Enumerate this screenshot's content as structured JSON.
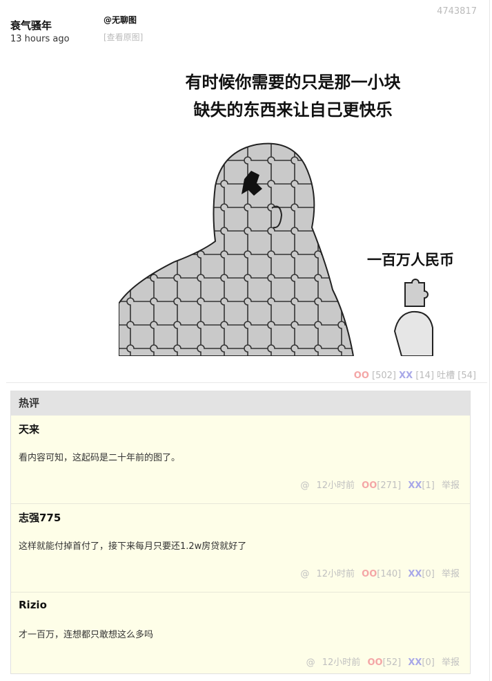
{
  "post": {
    "author": "衰气骚年",
    "time": "13 hours ago",
    "tag": "@无聊图",
    "view_original": "[查看原图]",
    "id": "4743817",
    "meme": {
      "line1": "有时候你需要的只是那一小块",
      "line2": "缺失的东西来让自己更快乐",
      "label": "一百万人民币"
    },
    "oo_label": "OO",
    "oo_count": "[502]",
    "xx_label": "XX",
    "xx_count": "[14]",
    "tucao": "吐槽 [54]"
  },
  "hot": {
    "title": "热评",
    "comments": [
      {
        "author": "天来",
        "text": "看内容可知，这起码是二十年前的图了。",
        "at": "@",
        "time": "12小时前",
        "oo": "OO",
        "oo_count": "[271]",
        "xx": "XX",
        "xx_count": "[1]",
        "report": "举报"
      },
      {
        "author": "志强775",
        "text": "这样就能付掉首付了，接下来每月只要还1.2w房贷就好了",
        "at": "@",
        "time": "12小时前",
        "oo": "OO",
        "oo_count": "[140]",
        "xx": "XX",
        "xx_count": "[0]",
        "report": "举报"
      },
      {
        "author": "Rizio",
        "text": "才一百万，连想都只敢想这么多吗",
        "at": "@",
        "time": "12小时前",
        "oo": "OO",
        "oo_count": "[52]",
        "xx": "XX",
        "xx_count": "[0]",
        "report": "举报"
      }
    ]
  }
}
